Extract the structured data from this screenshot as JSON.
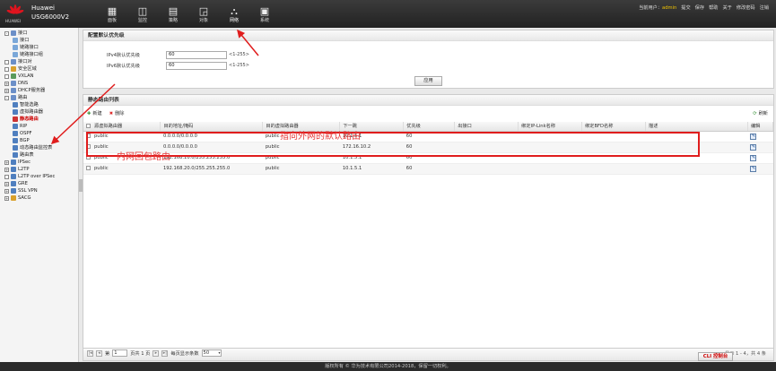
{
  "header": {
    "logo_text": "HUAWEI",
    "brand_line1": "Huawei",
    "brand_line2": "USG6000V2",
    "nav": [
      {
        "label": "面板",
        "icon": "dashboard-icon",
        "glyph": "▦"
      },
      {
        "label": "监控",
        "icon": "monitor-icon",
        "glyph": "◫"
      },
      {
        "label": "策略",
        "icon": "policy-icon",
        "glyph": "▤"
      },
      {
        "label": "对象",
        "icon": "object-icon",
        "glyph": "◲"
      },
      {
        "label": "网络",
        "icon": "network-icon",
        "glyph": "⛬"
      },
      {
        "label": "系统",
        "icon": "system-icon",
        "glyph": "▣"
      }
    ],
    "user_label": "当前用户：",
    "user": "admin",
    "links": [
      "提交",
      "保存",
      "帮助",
      "关于",
      "修改密码",
      "注销"
    ]
  },
  "sidebar": {
    "items": [
      {
        "label": "接口",
        "indent": 0,
        "toggle": "-",
        "color": "#6b8fc8"
      },
      {
        "label": "接口",
        "indent": 1,
        "toggle": "",
        "color": "#7aa7d8"
      },
      {
        "label": "链路接口",
        "indent": 1,
        "toggle": "",
        "color": "#7aa7d8"
      },
      {
        "label": "链路接口组",
        "indent": 1,
        "toggle": "",
        "color": "#7aa7d8"
      },
      {
        "label": "接口对",
        "indent": 0,
        "toggle": "",
        "color": "#6b8fc8"
      },
      {
        "label": "安全区域",
        "indent": 0,
        "toggle": "",
        "color": "#d9a12c"
      },
      {
        "label": "VXLAN",
        "indent": 0,
        "toggle": "",
        "color": "#5a9a5a"
      },
      {
        "label": "DNS",
        "indent": 0,
        "toggle": "+",
        "color": "#6b8fc8"
      },
      {
        "label": "DHCP服务器",
        "indent": 0,
        "toggle": "+",
        "color": "#6b8fc8"
      },
      {
        "label": "路由",
        "indent": 0,
        "toggle": "-",
        "color": "#6b8fc8"
      },
      {
        "label": "智能选路",
        "indent": 1,
        "toggle": "",
        "color": "#4f7fbf"
      },
      {
        "label": "虚拟路由器",
        "indent": 1,
        "toggle": "",
        "color": "#4f7fbf"
      },
      {
        "label": "静态路由",
        "indent": 1,
        "toggle": "",
        "color": "#c33",
        "active": true
      },
      {
        "label": "RIP",
        "indent": 1,
        "toggle": "",
        "color": "#4f7fbf"
      },
      {
        "label": "OSPF",
        "indent": 1,
        "toggle": "",
        "color": "#4f7fbf"
      },
      {
        "label": "BGP",
        "indent": 1,
        "toggle": "",
        "color": "#4f7fbf"
      },
      {
        "label": "动态路由监控表",
        "indent": 1,
        "toggle": "",
        "color": "#4f7fbf"
      },
      {
        "label": "路由表",
        "indent": 1,
        "toggle": "",
        "color": "#4f7fbf"
      },
      {
        "label": "IPSec",
        "indent": 0,
        "toggle": "+",
        "color": "#4f7fbf"
      },
      {
        "label": "L2TP",
        "indent": 0,
        "toggle": "+",
        "color": "#4f7fbf"
      },
      {
        "label": "L2TP over IPSec",
        "indent": 0,
        "toggle": "",
        "color": "#4f7fbf"
      },
      {
        "label": "GRE",
        "indent": 0,
        "toggle": "+",
        "color": "#4f7fbf"
      },
      {
        "label": "SSL VPN",
        "indent": 0,
        "toggle": "+",
        "color": "#4f7fbf"
      },
      {
        "label": "SACG",
        "indent": 0,
        "toggle": "+",
        "color": "#d9a12c"
      }
    ]
  },
  "priority_panel": {
    "title": "配置默认优先级",
    "ipv4_label": "IPv4默认优先级",
    "ipv4_value": "60",
    "ipv4_range": "<1-255>",
    "ipv6_label": "IPv6默认优先级",
    "ipv6_value": "60",
    "ipv6_range": "<1-255>",
    "apply_label": "应用"
  },
  "route_panel": {
    "title": "静态路由列表",
    "new_label": "新建",
    "delete_label": "删除",
    "refresh_label": "刷新",
    "columns": [
      "源虚拟路由器",
      "目的地址/掩码",
      "目的虚拟路由器",
      "下一跳",
      "优先级",
      "出接口",
      "绑定IP-Link名称",
      "绑定BFD名称",
      "描述",
      "编辑"
    ],
    "rows": [
      [
        "public",
        "0.0.0.0/0.0.0.0",
        "public",
        "10.1.5.1",
        "60",
        "",
        "",
        "",
        ""
      ],
      [
        "public",
        "0.0.0.0/0.0.0.0",
        "public",
        "172.16.10.2",
        "60",
        "",
        "",
        "",
        ""
      ],
      [
        "public",
        "192.168.10.0/255.255.255.0",
        "public",
        "10.1.5.1",
        "60",
        "",
        "",
        "",
        ""
      ],
      [
        "public",
        "192.168.20.0/255.255.255.0",
        "public",
        "10.1.5.1",
        "60",
        "",
        "",
        "",
        ""
      ]
    ],
    "pager": {
      "page_prefix": "第",
      "page_value": "1",
      "page_suffix": "页共 1 页",
      "per_page_label": "每页显示条数",
      "per_page_value": "50",
      "summary": "显示 1 - 4，共 4 条"
    }
  },
  "annotations": {
    "default_route_note": "指向外网的默认路由",
    "internal_route_note": "内网回包路由",
    "color": "#e53a3a"
  },
  "cli_label": "CLI 控制台",
  "footer": "版权所有 © 华为技术有限公司2014-2018，保留一切权利。"
}
